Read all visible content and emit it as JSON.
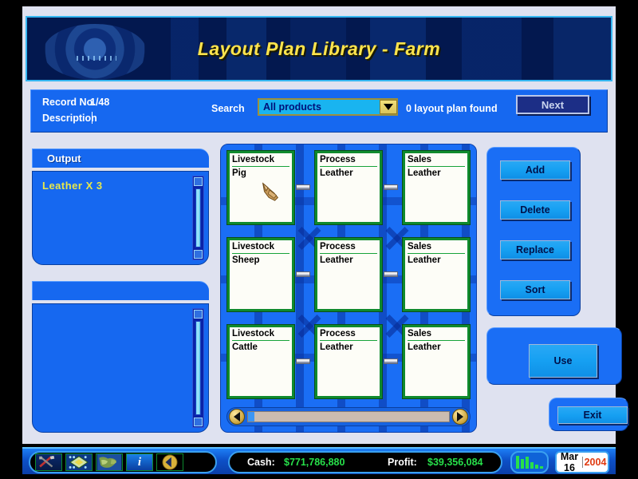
{
  "window": {
    "title": "Layout Plan Library - Farm"
  },
  "recordbar": {
    "record_label": "Record No.",
    "record_value": "1/48",
    "description_label": "Description",
    "description_value": "",
    "search_label": "Search",
    "search_selected": "All products",
    "search_options": [
      "All products"
    ],
    "result_text": "0 layout plan found",
    "next_label": "Next"
  },
  "output_panel": {
    "title": "Output",
    "items": [
      "Leather X 3"
    ]
  },
  "second_panel": {
    "title": "",
    "items": []
  },
  "grid": {
    "rows": [
      {
        "cells": [
          {
            "header": "Livestock",
            "sub": "Pig"
          },
          {
            "header": "Process",
            "sub": "Leather"
          },
          {
            "header": "Sales",
            "sub": "Leather"
          }
        ]
      },
      {
        "cells": [
          {
            "header": "Livestock",
            "sub": "Sheep"
          },
          {
            "header": "Process",
            "sub": "Leather"
          },
          {
            "header": "Sales",
            "sub": "Leather"
          }
        ]
      },
      {
        "cells": [
          {
            "header": "Livestock",
            "sub": "Cattle"
          },
          {
            "header": "Process",
            "sub": "Leather"
          },
          {
            "header": "Sales",
            "sub": "Leather"
          }
        ]
      }
    ]
  },
  "actions": {
    "add": "Add",
    "delete": "Delete",
    "replace": "Replace",
    "sort": "Sort",
    "use": "Use",
    "exit": "Exit"
  },
  "status": {
    "icons": [
      "tools-icon",
      "layout-diamond-icon",
      "world-map-icon",
      "info-icon",
      "back-arrow-icon"
    ],
    "cash_label": "Cash:",
    "cash_value": "$771,786,880",
    "profit_label": "Profit:",
    "profit_value": "$39,356,084",
    "chart_icon": "bar-chart-icon",
    "date_month": "Mar 16",
    "date_year": "2004"
  },
  "colors": {
    "panel_blue": "#1668f0",
    "title_yellow": "#ffe44d",
    "output_item_yellow": "#e8e84a",
    "money_green": "#27e04a",
    "year_orange": "#e03a10",
    "card_border_green": "#0f8a2e"
  }
}
